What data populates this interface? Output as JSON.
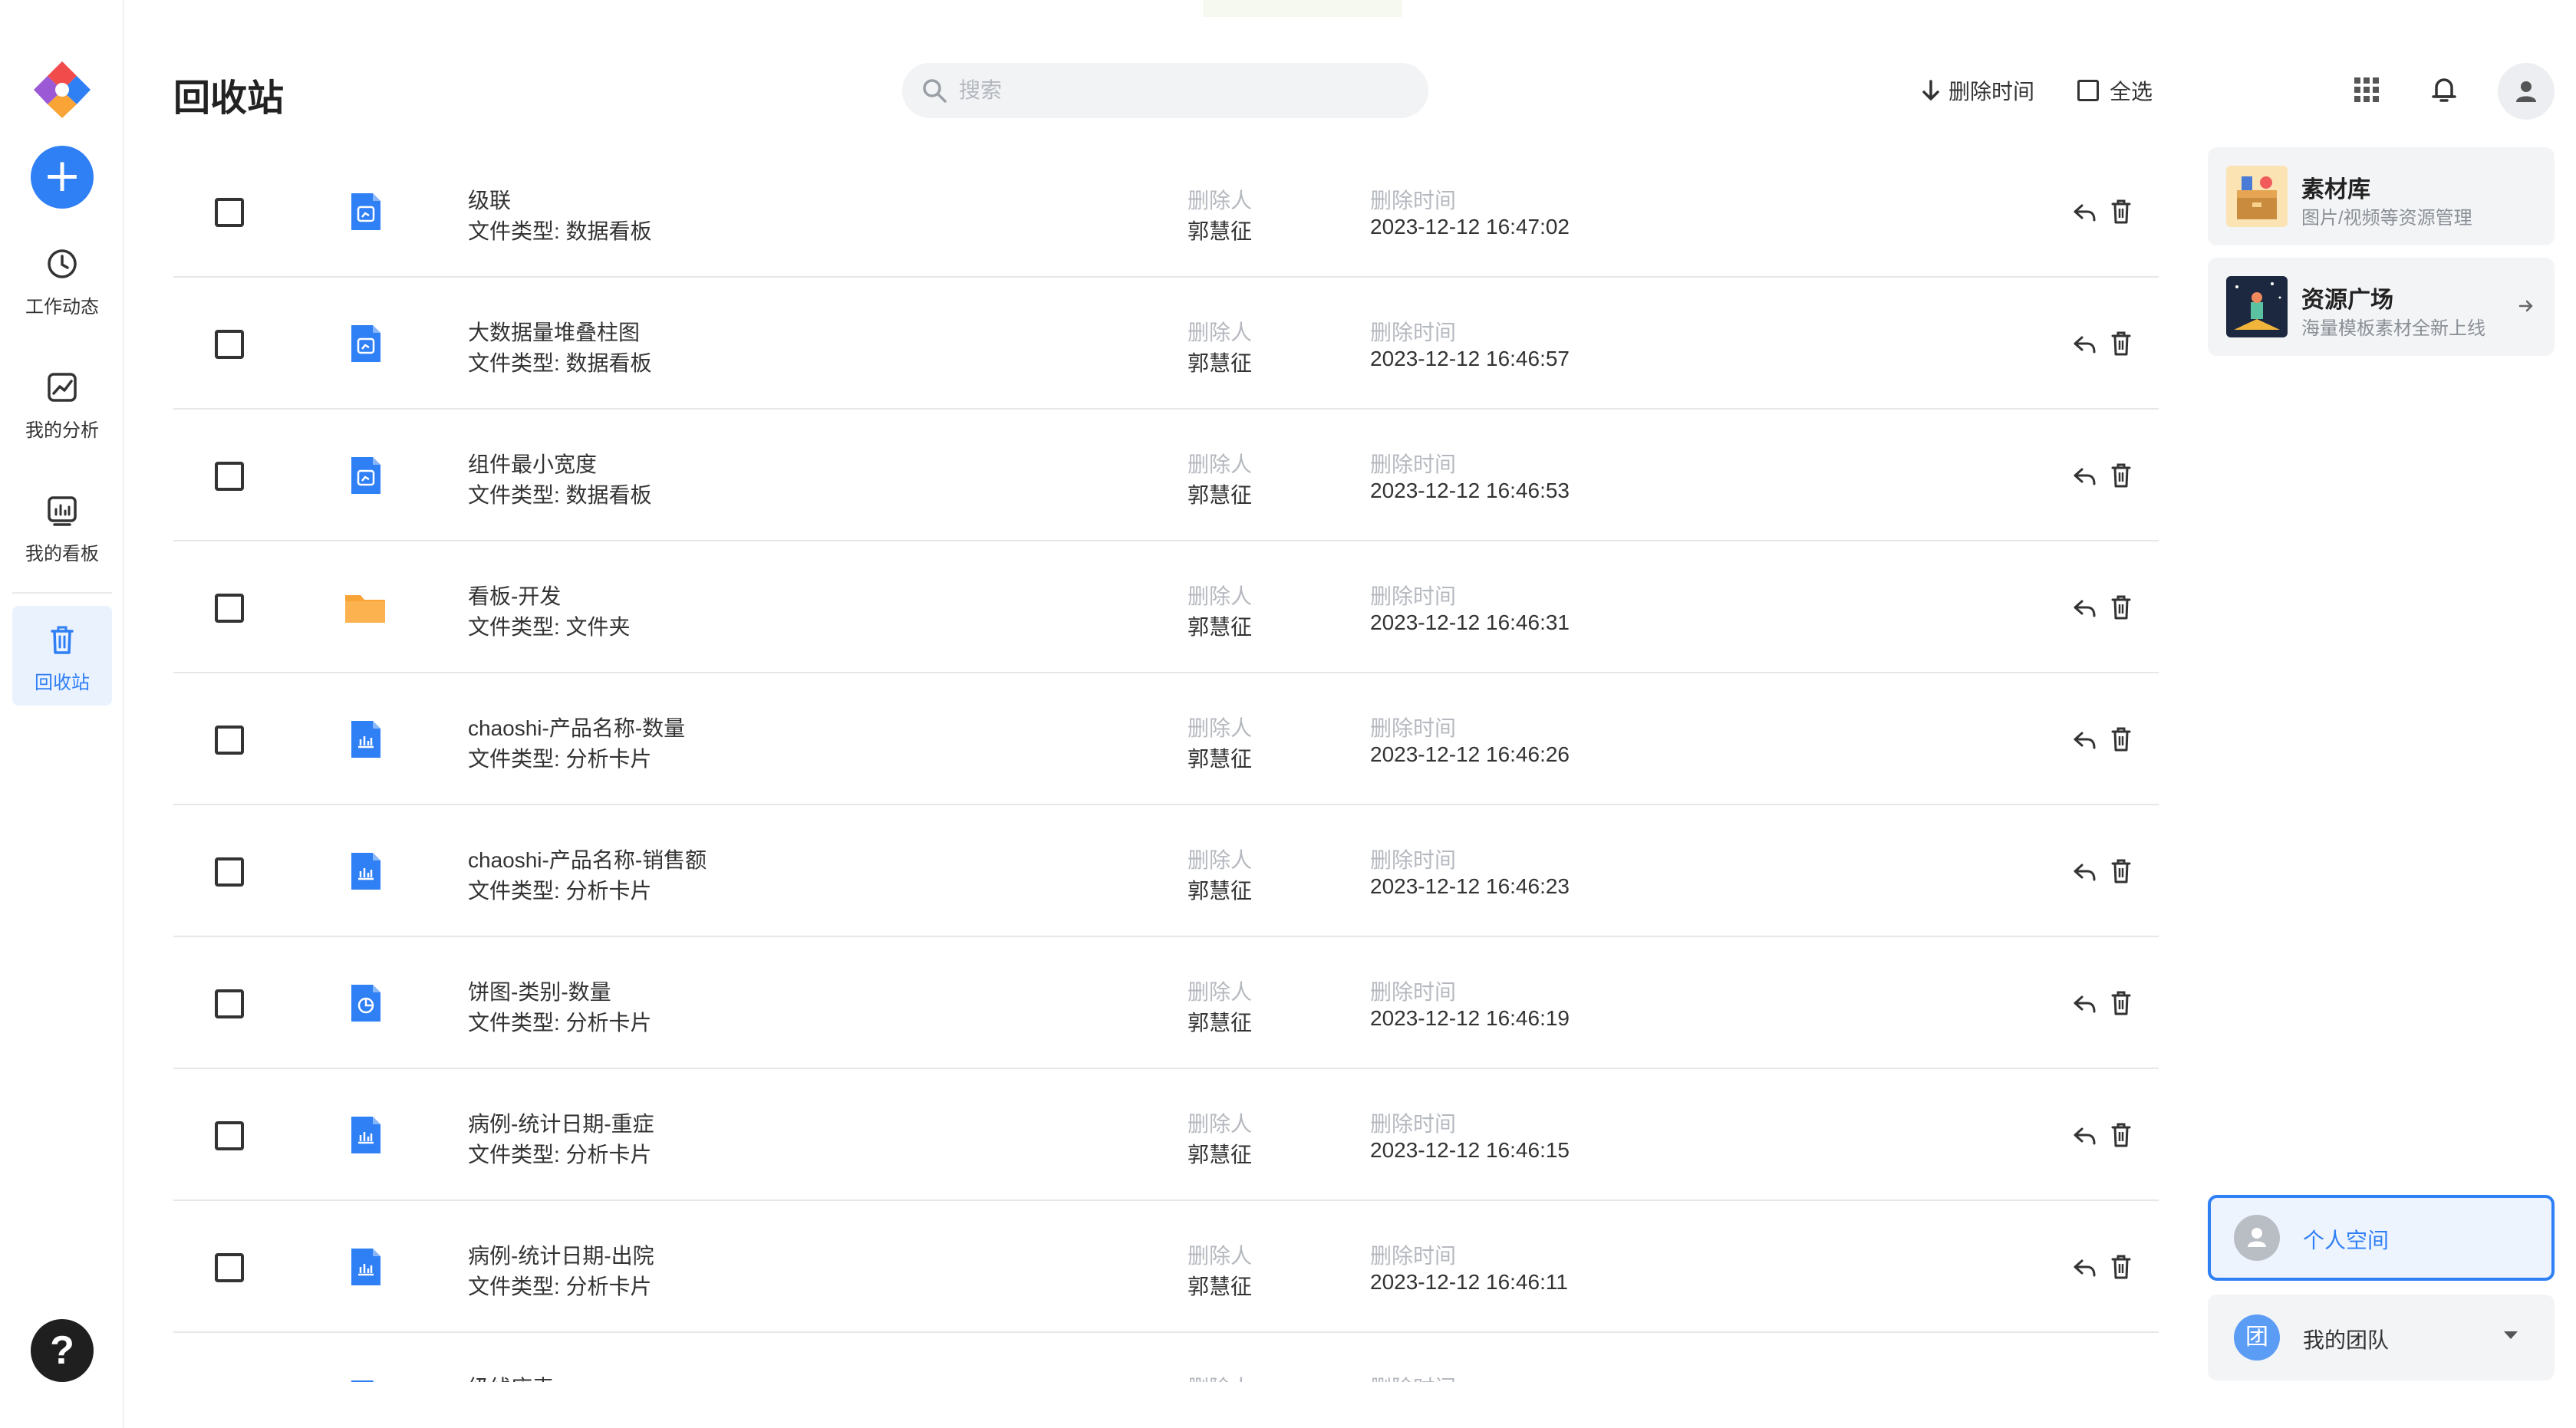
{
  "nav": {
    "items": [
      {
        "label": "工作动态",
        "icon": "clock-icon"
      },
      {
        "label": "我的分析",
        "icon": "analysis-icon"
      },
      {
        "label": "我的看板",
        "icon": "dashboard-icon"
      },
      {
        "label": "回收站",
        "icon": "trash-icon",
        "active": true
      }
    ],
    "help": "?"
  },
  "header": {
    "title": "回收站",
    "search_placeholder": "搜索",
    "sort_label": "删除时间",
    "select_all_label": "全选"
  },
  "list": {
    "deleted_by_label": "删除人",
    "deleted_time_label": "删除时间",
    "rows": [
      {
        "name": "级联",
        "type": "文件类型: 数据看板",
        "icon": "dashboard-file-icon",
        "deleted_by": "郭慧征",
        "deleted_time": "2023-12-12 16:47:02"
      },
      {
        "name": "大数据量堆叠柱图",
        "type": "文件类型: 数据看板",
        "icon": "dashboard-file-icon",
        "deleted_by": "郭慧征",
        "deleted_time": "2023-12-12 16:46:57"
      },
      {
        "name": "组件最小宽度",
        "type": "文件类型: 数据看板",
        "icon": "dashboard-file-icon",
        "deleted_by": "郭慧征",
        "deleted_time": "2023-12-12 16:46:53"
      },
      {
        "name": "看板-开发",
        "type": "文件类型: 文件夹",
        "icon": "folder-icon",
        "deleted_by": "郭慧征",
        "deleted_time": "2023-12-12 16:46:31"
      },
      {
        "name": "chaoshi-产品名称-数量",
        "type": "文件类型: 分析卡片",
        "icon": "bar-chart-file-icon",
        "deleted_by": "郭慧征",
        "deleted_time": "2023-12-12 16:46:26"
      },
      {
        "name": "chaoshi-产品名称-销售额",
        "type": "文件类型: 分析卡片",
        "icon": "bar-chart-file-icon",
        "deleted_by": "郭慧征",
        "deleted_time": "2023-12-12 16:46:23"
      },
      {
        "name": "饼图-类别-数量",
        "type": "文件类型: 分析卡片",
        "icon": "pie-chart-file-icon",
        "deleted_by": "郭慧征",
        "deleted_time": "2023-12-12 16:46:19"
      },
      {
        "name": "病例-统计日期-重症",
        "type": "文件类型: 分析卡片",
        "icon": "bar-chart-file-icon",
        "deleted_by": "郭慧征",
        "deleted_time": "2023-12-12 16:46:15"
      },
      {
        "name": "病例-统计日期-出院",
        "type": "文件类型: 分析卡片",
        "icon": "bar-chart-file-icon",
        "deleted_by": "郭慧征",
        "deleted_time": "2023-12-12 16:46:11"
      },
      {
        "name": "级线座表",
        "type": "",
        "icon": "dashboard-file-icon",
        "deleted_by": "",
        "deleted_time": ""
      }
    ]
  },
  "right_panel": {
    "cards": [
      {
        "title": "素材库",
        "subtitle": "图片/视频等资源管理"
      },
      {
        "title": "资源广场",
        "subtitle": "海量模板素材全新上线"
      }
    ],
    "spaces": {
      "personal": "个人空间",
      "team": "我的团队",
      "team_avatar": "团"
    }
  },
  "colors": {
    "accent": "#2f7ff5",
    "folder": "#f8a437",
    "file": "#2f7ff5"
  }
}
